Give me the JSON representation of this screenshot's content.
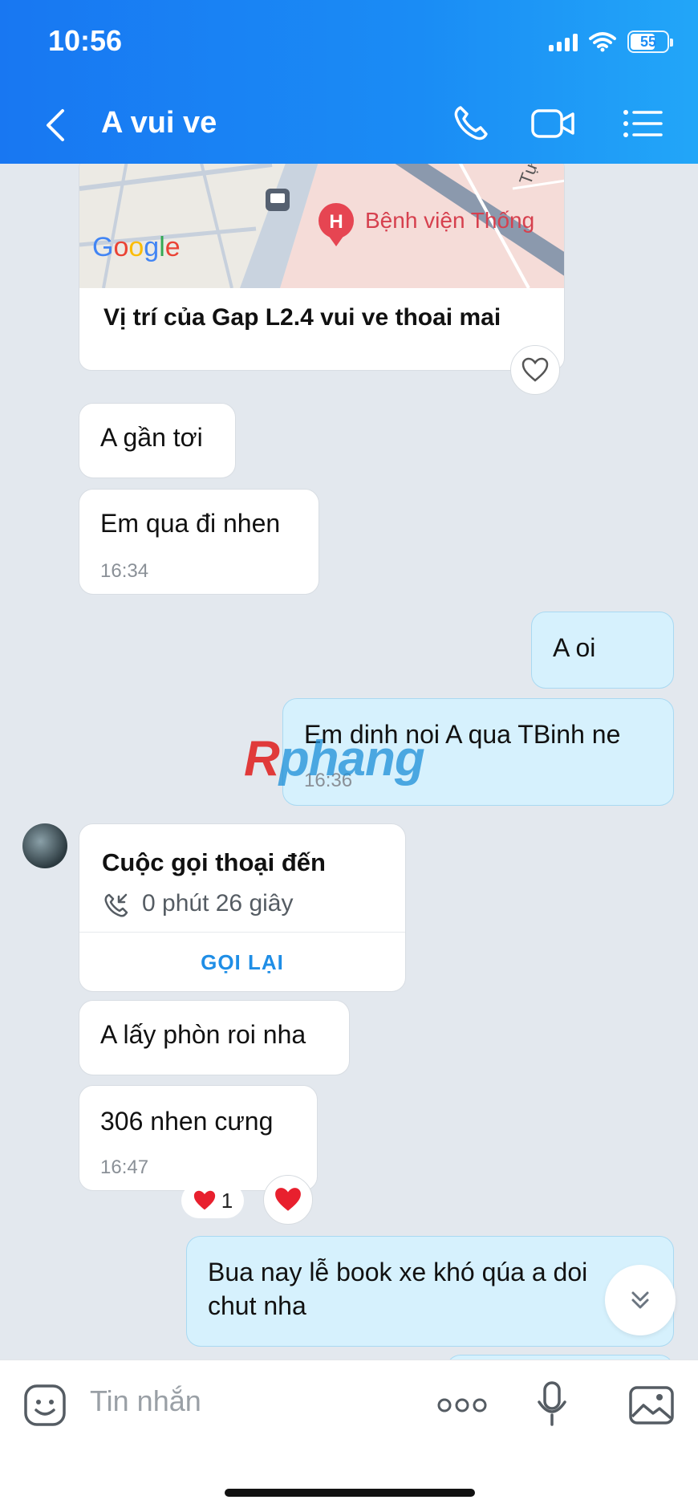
{
  "status": {
    "time": "10:56",
    "battery": "55"
  },
  "header": {
    "title": "A vui ve"
  },
  "map_card": {
    "title": "Vị trí của Gap L2.4 vui ve thoai mai",
    "google_label": "Google",
    "place_label": "Bệnh viện Thống",
    "street_label": "Tự"
  },
  "messages": [
    {
      "text": "A gần tơi"
    },
    {
      "text": "Em qua đi nhen",
      "time": "16:34"
    },
    {
      "text": "A oi"
    },
    {
      "text": "Em dinh noi A qua TBinh ne",
      "time": "16:36"
    },
    {
      "text": "A lấy phòn roi nha"
    },
    {
      "text": "306 nhen cưng",
      "time": "16:47"
    },
    {
      "text_line1": "Bua nay lễ book xe khó qúa a doi",
      "text_line2": "chut nha"
    }
  ],
  "call_card": {
    "title": "Cuộc gọi thoại đến",
    "duration": "0 phút 26 giây",
    "action": "GỌI LẠI"
  },
  "reaction": {
    "emoji": "❤️",
    "count": "1"
  },
  "watermark": {
    "first": "R",
    "rest": "phang"
  },
  "composer": {
    "placeholder": "Tin nhắn"
  },
  "colors": {
    "header": "#1a8cf5",
    "outgoing": "#d6f1fd",
    "incoming": "#ffffff",
    "accent": "#1f8ee6",
    "heart": "#e8202e"
  },
  "icons": [
    "back-icon",
    "phone-icon",
    "video-icon",
    "menu-icon",
    "heart-icon",
    "call-incoming-icon",
    "chevron-down-icon",
    "sticker-icon",
    "more-icon",
    "mic-icon",
    "image-icon"
  ]
}
